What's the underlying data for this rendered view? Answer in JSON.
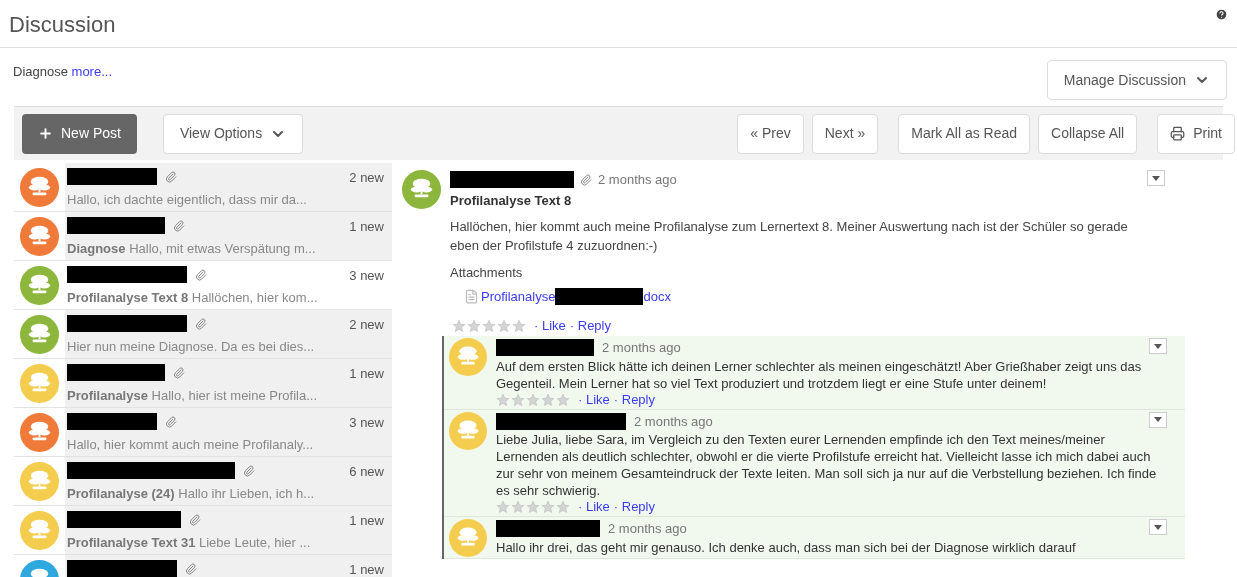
{
  "title": "Discussion",
  "description": {
    "text": "Diagnose",
    "link": "more..."
  },
  "manage_button": "Manage Discussion",
  "toolbar": {
    "new_post": "New Post",
    "view_options": "View Options",
    "buttons": [
      "« Prev",
      "Next »",
      "Mark All as Read",
      "Collapse All"
    ],
    "print": "Print"
  },
  "threads": [
    {
      "color": "#f07a3a",
      "preview": "Hallo,   ich dachte eigentlich, dass mir da...",
      "new": "2 new",
      "selected": false
    },
    {
      "color": "#f07a3a",
      "subject": "Diagnose",
      "preview": "Hallo, mit etwas Verspätung m...",
      "new": "1 new",
      "selected": false
    },
    {
      "color": "#8cb63c",
      "subject": "Profilanalyse Text 8",
      "preview": "Hallöchen, hier kom...",
      "new": "3 new",
      "selected": true
    },
    {
      "color": "#8cb63c",
      "preview": "Hier nun meine Diagnose. Da es bei dies...",
      "new": "2 new",
      "selected": false
    },
    {
      "color": "#f5cd4e",
      "subject": "Profilanalyse",
      "preview": "Hallo, hier ist meine Profila...",
      "new": "1 new",
      "selected": false
    },
    {
      "color": "#f07a3a",
      "preview": "Hallo, hier kommt auch meine Profilanaly...",
      "new": "3 new",
      "selected": false
    },
    {
      "color": "#f5cd4e",
      "subject": "Profilanalyse (24)",
      "preview": "Hallo ihr Lieben,  ich h...",
      "new": "6 new",
      "selected": false
    },
    {
      "color": "#f5cd4e",
      "subject": "Profilanalyse Text 31",
      "preview": "Liebe Leute,   hier ...",
      "new": "1 new",
      "selected": false
    },
    {
      "color": "#2fa8e0",
      "new": "1 new",
      "selected": false
    }
  ],
  "post": {
    "color": "#8cb63c",
    "time": "2 months ago",
    "title": "Profilanalyse Text 8",
    "body": "Hallöchen, hier kommt auch meine Profilanalyse zum Lernertext 8. Meiner Auswertung nach ist der Schüler so gerade eben der Profilstufe 4 zuzuordnen:-)",
    "attachments_label": "Attachments",
    "attachment": {
      "start": "Profilanalyse",
      "end": "docx"
    },
    "stars": 0,
    "like": "· Like",
    "reply": "· Reply"
  },
  "replies": [
    {
      "color": "#f5cd4e",
      "time": "2 months ago",
      "body": "Auf dem ersten Blick hätte ich deinen Lerner schlechter als meinen eingeschätzt! Aber Grießhaber zeigt uns das Gegenteil. Mein Lerner hat so viel Text produziert und trotzdem liegt er eine Stufe unter deinem!",
      "stars": 0,
      "like": "· Like",
      "reply": "· Reply"
    },
    {
      "color": "#f5cd4e",
      "time": "2 months ago",
      "body": "Liebe Julia, liebe Sara, im Vergleich zu den Texten eurer Lernenden empfinde ich den Text meines/meiner Lernenden als deutlich schlechter, obwohl er die vierte Profilstufe erreicht hat. Vielleicht lasse ich mich dabei auch zur sehr von meinem Gesamteindruck der Texte leiten. Man soll sich ja nur auf die Verbstellung beziehen. Ich finde es sehr schwierig.",
      "stars": 0,
      "like": "· Like",
      "reply": "· Reply"
    },
    {
      "color": "#f5cd4e",
      "time": "2 months ago",
      "body": "Hallo ihr drei, das geht mir genauso. Ich denke auch, dass man sich bei der Diagnose wirklich darauf"
    }
  ]
}
